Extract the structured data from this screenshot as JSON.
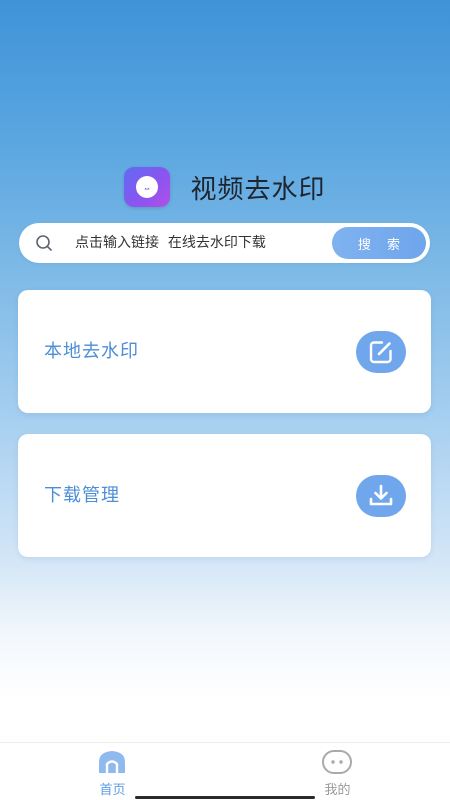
{
  "header": {
    "app_icon": "play-video-icon",
    "title": "视频去水印"
  },
  "search": {
    "icon": "search-icon",
    "placeholder": "点击输入链接  在线去水印下载",
    "button_label": "搜 索"
  },
  "cards": [
    {
      "label": "本地去水印",
      "icon": "edit-icon"
    },
    {
      "label": "下载管理",
      "icon": "download-icon"
    }
  ],
  "tab_bar": {
    "tabs": [
      {
        "label": "首页",
        "icon": "home-icon",
        "active": true
      },
      {
        "label": "我的",
        "icon": "profile-face-icon",
        "active": false
      }
    ]
  },
  "colors": {
    "accent": "#70a6ec",
    "card_text": "#4d8ed8",
    "tab_active": "#5d9be8",
    "tab_inactive": "#9a9a9a"
  }
}
